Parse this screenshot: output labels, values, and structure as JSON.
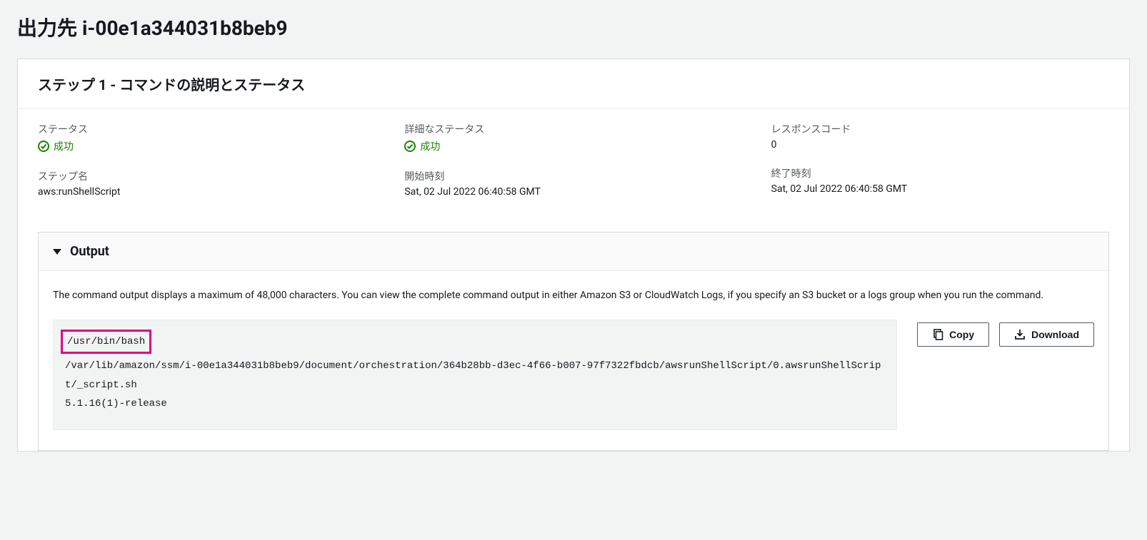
{
  "page_title": "出力先 i-00e1a344031b8beb9",
  "step_panel": {
    "title": "ステップ 1 - コマンドの説明とステータス",
    "status": {
      "label": "ステータス",
      "value": "成功"
    },
    "detail_status": {
      "label": "詳細なステータス",
      "value": "成功"
    },
    "response_code": {
      "label": "レスポンスコード",
      "value": "0"
    },
    "step_name": {
      "label": "ステップ名",
      "value": "aws:runShellScript"
    },
    "start_time": {
      "label": "開始時刻",
      "value": "Sat, 02 Jul 2022 06:40:58 GMT"
    },
    "end_time": {
      "label": "終了時刻",
      "value": "Sat, 02 Jul 2022 06:40:58 GMT"
    }
  },
  "output": {
    "title": "Output",
    "note": "The command output displays a maximum of 48,000 characters. You can view the complete command output in either Amazon S3 or CloudWatch Logs, if you specify an S3 bucket or a logs group when you run the command.",
    "highlight_line": "/usr/bin/bash",
    "lines": [
      "/var/lib/amazon/ssm/i-00e1a344031b8beb9/document/orchestration/364b28bb-d3ec-4f66-b007-97f7322fbdcb/awsrunShellScript/0.awsrunShellScript/_script.sh",
      "5.1.16(1)-release"
    ],
    "copy_label": "Copy",
    "download_label": "Download"
  }
}
